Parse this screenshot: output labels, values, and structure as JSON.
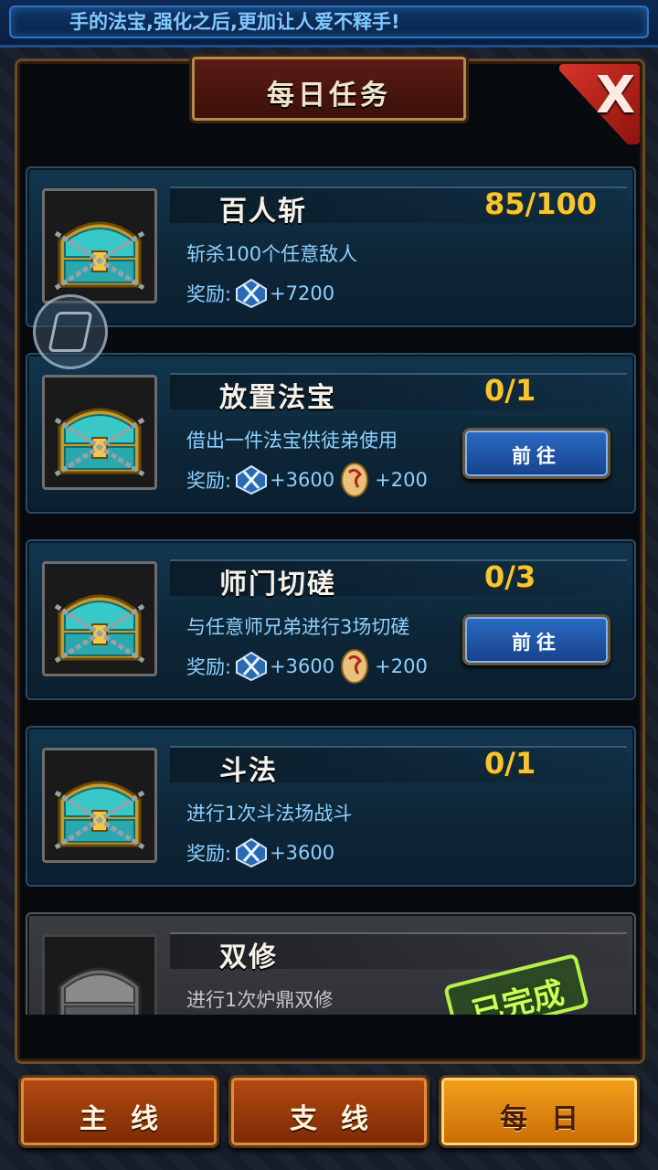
{
  "marquee": {
    "text": "手的法宝,强化之后,更加让人爱不释手!"
  },
  "dialog": {
    "title": "每日任务",
    "close_label": "X"
  },
  "tasks": [
    {
      "name": "百人斩",
      "progress": "85/100",
      "desc": "斩杀100个任意敌人",
      "reward_label": "奖励:",
      "gem_reward": "+7200",
      "coin_reward": "",
      "action": "",
      "completed": false
    },
    {
      "name": "放置法宝",
      "progress": "0/1",
      "desc": "借出一件法宝供徒弟使用",
      "reward_label": "奖励:",
      "gem_reward": "+3600",
      "coin_reward": "+200",
      "action": "前往",
      "completed": false
    },
    {
      "name": "师门切磋",
      "progress": "0/3",
      "desc": "与任意师兄弟进行3场切磋",
      "reward_label": "奖励:",
      "gem_reward": "+3600",
      "coin_reward": "+200",
      "action": "前往",
      "completed": false
    },
    {
      "name": "斗法",
      "progress": "0/1",
      "desc": "进行1次斗法场战斗",
      "reward_label": "奖励:",
      "gem_reward": "+3600",
      "coin_reward": "",
      "action": "",
      "completed": false
    },
    {
      "name": "双修",
      "progress": "",
      "desc": "进行1次炉鼎双修",
      "reward_label": "",
      "gem_reward": "",
      "coin_reward": "",
      "action": "",
      "completed": true,
      "stamp": "已完成"
    }
  ],
  "tabs": [
    {
      "label": "主线",
      "active": false
    },
    {
      "label": "支线",
      "active": false
    },
    {
      "label": "每日",
      "active": true
    }
  ],
  "colors": {
    "progress": "#f6c630",
    "desc": "#8ed0ff",
    "stamp": "#c9ff58",
    "tab_active": "#f2a21c"
  }
}
